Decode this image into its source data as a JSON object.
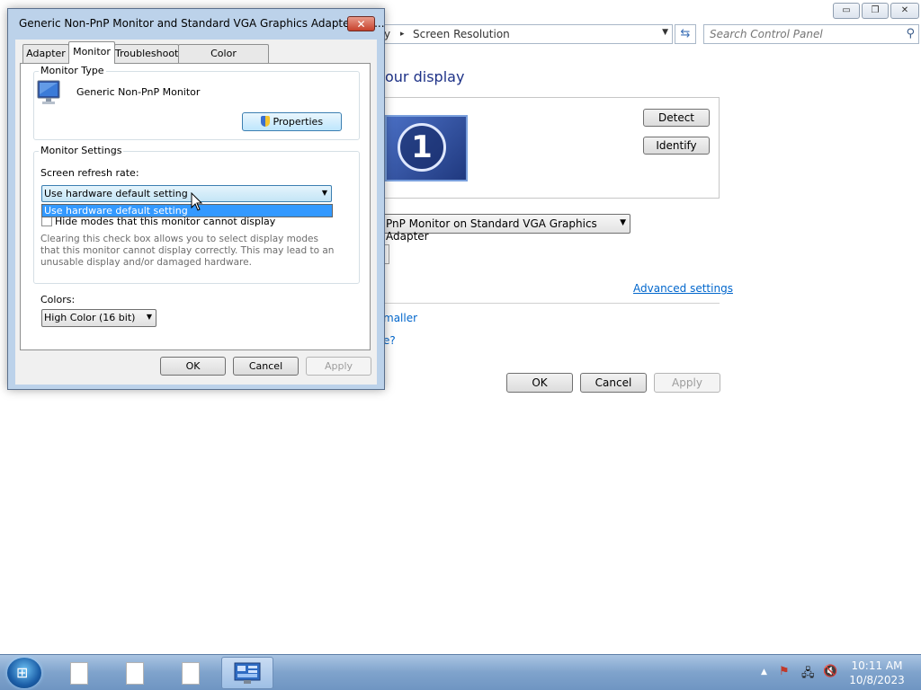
{
  "window": {
    "caption_minimize": "▭",
    "caption_maximize": "❐",
    "caption_close": "✕"
  },
  "address": {
    "fragment": "y",
    "separator": "▸",
    "current": "Screen Resolution",
    "search_placeholder": "Search Control Panel"
  },
  "main": {
    "heading": "our display",
    "monitor_number": "1",
    "detect_label": "Detect",
    "identify_label": "Identify",
    "display_select": "PnP Monitor on Standard VGA Graphics Adapter",
    "advanced_link": "Advanced settings",
    "link_smaller": "maller",
    "link_question": "e?",
    "ok_label": "OK",
    "cancel_label": "Cancel",
    "apply_label": "Apply"
  },
  "dialog": {
    "title": "Generic Non-PnP Monitor and Standard VGA Graphics Adapter Pro...",
    "close_glyph": "✕",
    "tabs": [
      {
        "label": "Adapter"
      },
      {
        "label": "Monitor"
      },
      {
        "label": "Troubleshoot"
      },
      {
        "label": "Color Management"
      }
    ],
    "monitor_type_group": "Monitor Type",
    "monitor_name": "Generic Non-PnP Monitor",
    "properties_label": "Properties",
    "monitor_settings_group": "Monitor Settings",
    "refresh_label": "Screen refresh rate:",
    "refresh_value": "Use hardware default setting",
    "refresh_options": [
      "Use hardware default setting"
    ],
    "hide_modes_label": "Hide modes that this monitor cannot display",
    "hide_modes_desc": "Clearing this check box allows you to select display modes that this monitor cannot display correctly. This may lead to an unusable display and/or damaged hardware.",
    "colors_label": "Colors:",
    "colors_value": "High Color (16 bit)",
    "ok_label": "OK",
    "cancel_label": "Cancel",
    "apply_label": "Apply"
  },
  "taskbar": {
    "clock_time": "10:11 AM",
    "clock_date": "10/8/2023"
  }
}
